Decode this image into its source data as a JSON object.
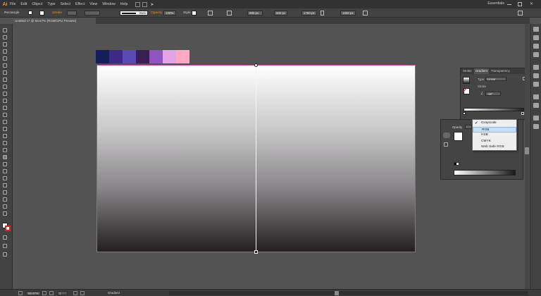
{
  "app": {
    "logo": "Ai",
    "workspace": "Essentials"
  },
  "menu": {
    "items": [
      "File",
      "Edit",
      "Object",
      "Type",
      "Select",
      "Effect",
      "View",
      "Window",
      "Help"
    ]
  },
  "control_bar": {
    "selection": "Rectangle",
    "stroke_label": "Stroke",
    "brush": "Basic",
    "opacity_label": "Opacity",
    "opacity_value": "100%",
    "style_label": "Style",
    "x_value": "880 px",
    "y_value": "500 px",
    "w_value": "1760 px",
    "h_value": "1000 px"
  },
  "document": {
    "tab_title": "Untitled-1* @ 66.67% (RGB/GPU Preview)"
  },
  "swatches": [
    "#121f5c",
    "#3e2a86",
    "#5b4ab5",
    "#3a1f55",
    "#8f55c0",
    "#e2a3e7",
    "#ffa9c5"
  ],
  "gradient_panel": {
    "tabs": [
      "Stroke",
      "Gradient",
      "Transparency"
    ],
    "type_label": "Type:",
    "type_value": "Linear",
    "stroke_label": "Stroke",
    "angle_value": "-90°"
  },
  "color_panel": {
    "opacity_label": "Opacity"
  },
  "color_mode_menu": {
    "items": [
      {
        "label": "Grayscale",
        "checked": true
      },
      {
        "label": "RGB",
        "highlighted": true
      },
      {
        "label": "HSB"
      },
      {
        "label": "CMYK"
      },
      {
        "label": "Web Safe RGB"
      }
    ]
  },
  "status_bar": {
    "zoom": "66.67%",
    "page": "1",
    "tool": "Gradient"
  },
  "colors": {
    "accent": "#e5902c",
    "artboard_border": "#c050a0",
    "menu_highlight": "#c8dff5"
  }
}
